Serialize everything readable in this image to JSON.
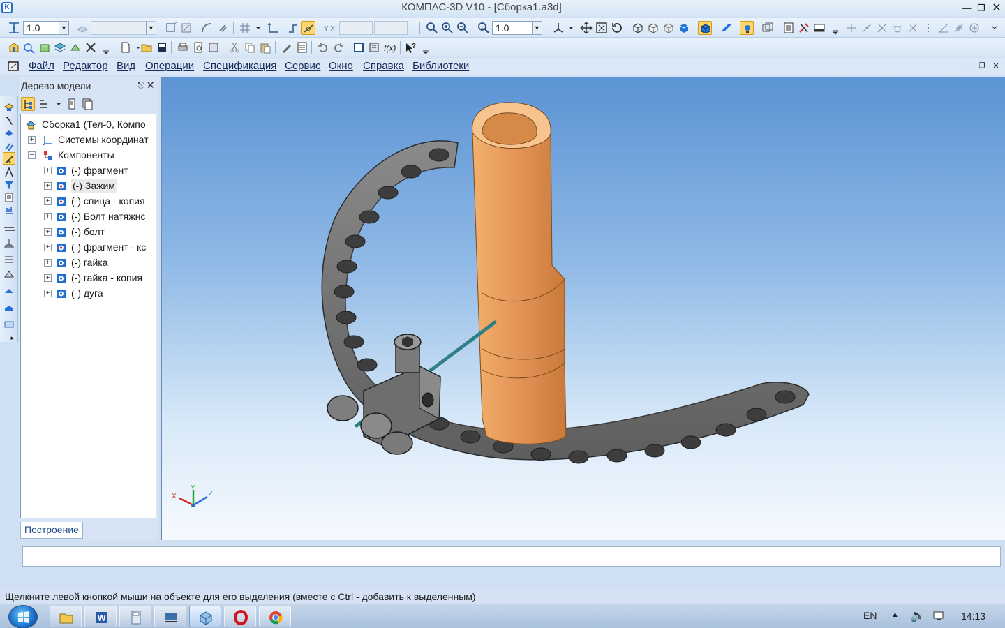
{
  "window": {
    "title": "КОМПАС-3D V10 - [Сборка1.a3d]",
    "controls": [
      "minimize",
      "restore",
      "close"
    ]
  },
  "toolbar": {
    "step_value": "1.0",
    "zoom_value": "1.0"
  },
  "menu": {
    "items": [
      "Файл",
      "Редактор",
      "Вид",
      "Операции",
      "Спецификация",
      "Сервис",
      "Окно",
      "Справка",
      "Библиотеки"
    ]
  },
  "model_tree": {
    "header": "Дерево модели",
    "root": "Сборка1 (Тел-0, Компо",
    "coord_systems": "Системы координат",
    "components_label": "Компоненты",
    "components": [
      "(-) фрагмент",
      "(-) Зажим",
      "(-) спица - копия",
      "(-) Болт натяжнс",
      "(-) болт",
      "(-) фрагмент - кс",
      "(-) гайка",
      "(-) гайка - копия",
      "(-) дуга"
    ],
    "tab": "Построение"
  },
  "axes": {
    "x": "X",
    "y": "Y",
    "z": "Z"
  },
  "status": {
    "message": "Щелкните левой кнопкой мыши на объекте для его выделения (вместе с Ctrl - добавить к выделенным)"
  },
  "taskbar": {
    "language": "EN",
    "time": "14:13",
    "apps": [
      "explorer",
      "word",
      "calculator",
      "network",
      "kompas",
      "opera",
      "chrome"
    ]
  },
  "colors": {
    "bone": "#e39a55",
    "metal": "#707070",
    "pin": "#2f7f86",
    "viewport_top": "#5b93d4"
  }
}
